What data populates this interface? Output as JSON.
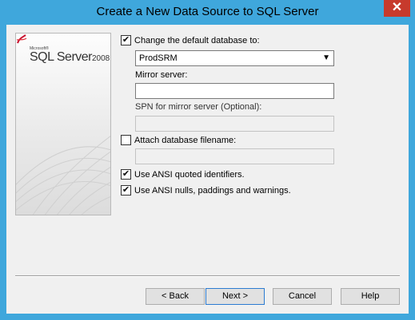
{
  "window": {
    "title": "Create a New Data Source to SQL Server",
    "close_label": "✕"
  },
  "banner": {
    "brand_small": "Microsoft®",
    "brand_name": "SQL Server",
    "brand_version": "2008"
  },
  "form": {
    "change_db": {
      "label": "Change the default database to:",
      "checked": true
    },
    "database_value": "ProdSRM",
    "mirror_server_label": "Mirror server:",
    "mirror_server_value": "",
    "spn_label": "SPN for mirror server (Optional):",
    "spn_value": "",
    "attach_db": {
      "label": "Attach database filename:",
      "checked": false
    },
    "attach_value": "",
    "ansi_quoted": {
      "label": "Use ANSI quoted identifiers.",
      "checked": true
    },
    "ansi_nulls": {
      "label": "Use ANSI nulls, paddings and warnings.",
      "checked": true
    }
  },
  "buttons": {
    "back": "< Back",
    "next": "Next >",
    "cancel": "Cancel",
    "help": "Help"
  },
  "check_glyph": "✔"
}
